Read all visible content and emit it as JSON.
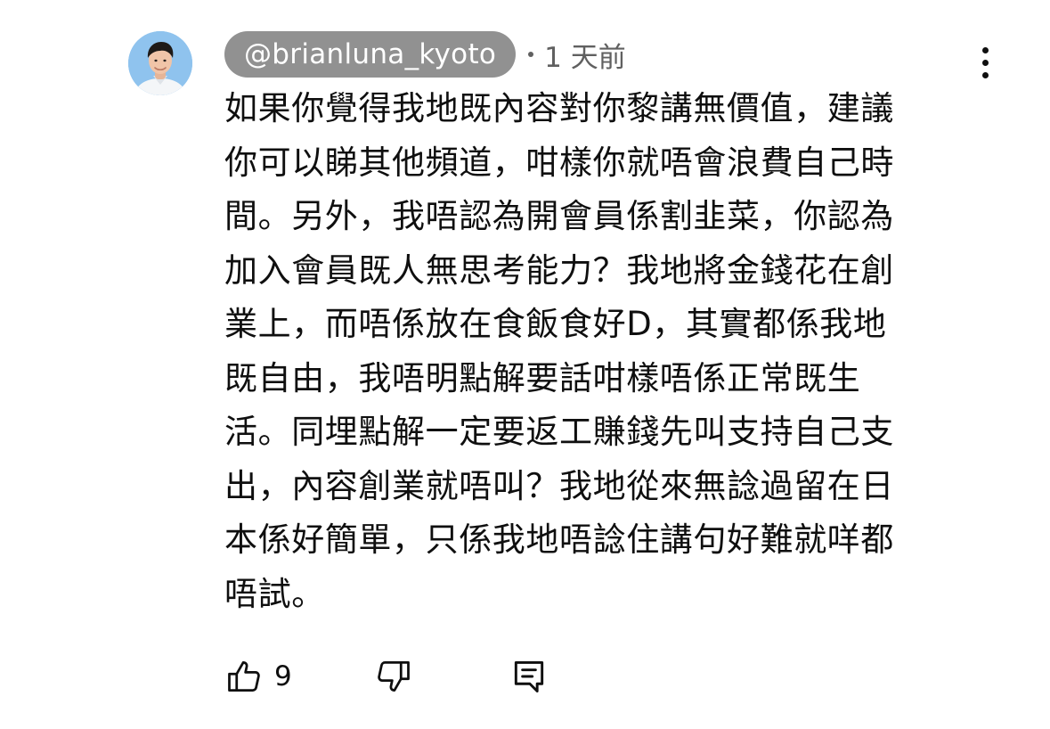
{
  "comment": {
    "author_handle": "@brianluna_kyoto",
    "time_ago": "1 天前",
    "lines": [
      "如果你覺得我地既內容對你黎講無價值，建議",
      "你可以睇其他頻道，咁樣你就唔會浪費自己時",
      "間。另外，我唔認為開會員係割韭菜，你認為",
      "加入會員既人無思考能力？我地將金錢花在創",
      "業上，而唔係放在食飯食好D，其實都係我地",
      "既自由，我唔明點解要話咁樣唔係正常既生",
      "活。同埋點解一定要返工賺錢先叫支持自己支",
      "出，內容創業就唔叫？我地從來無諗過留在日",
      "本係好簡單，只係我地唔諗住講句好難就咩都",
      "唔試。"
    ],
    "like_count": "9"
  },
  "icons": {
    "avatar": "avatar",
    "more": "more-vert-icon",
    "like": "thumb-up-icon",
    "dislike": "thumb-down-icon",
    "reply": "comment-reply-icon"
  },
  "colors": {
    "handle_chip_bg": "#919191",
    "meta_text": "#606060",
    "text": "#0f0f0f"
  }
}
